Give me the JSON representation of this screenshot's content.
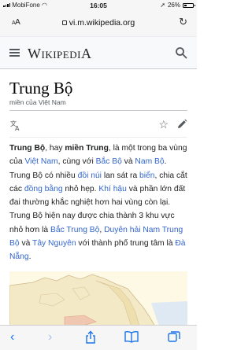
{
  "status_bar": {
    "carrier": "MobiFone",
    "time": "16:05",
    "battery": "26%"
  },
  "browser": {
    "text_size_label": "AA",
    "url": "vi.m.wikipedia.org"
  },
  "wiki": {
    "wordmark": "Wikipedia"
  },
  "page": {
    "title": "Trung Bộ",
    "subtitle": "miền của Việt Nam"
  },
  "article": {
    "p1_bold1": "Trung Bộ",
    "p1_t1": ", hay ",
    "p1_bold2": "miền Trung",
    "p1_t2": ", là một trong ba vùng của ",
    "link_vietnam": "Việt Nam",
    "p1_t3": ", cùng với ",
    "link_bacbo": "Bắc Bộ",
    "p1_t4": " và ",
    "link_nambo": "Nam Bộ",
    "p1_t5": ". Trung Bộ có nhiều ",
    "link_doinui": "đồi núi",
    "p1_t6": " lan sát ra ",
    "link_bien": "biển",
    "p1_t7": ", chia cắt các ",
    "link_dongbang": "đồng bằng",
    "p1_t8": " nhỏ hẹp. ",
    "link_khihau": "Khí hậu",
    "p1_t9": " và phần lớn đất đai thường khắc nghiệt hơn hai vùng còn lại. Trung Bộ hiện nay được chia thành 3 khu vực nhỏ hơn là ",
    "link_bactrungbo": "Bắc Trung Bộ",
    "p1_t10": ", ",
    "link_duyenhai": "Duyên hải Nam Trung Bộ",
    "p1_t11": " và ",
    "link_taynguyen": "Tây Nguyên",
    "p1_t12": " với thành phố trung tâm là ",
    "link_danang": "Đà Nẵng",
    "p1_t13": "."
  },
  "colors": {
    "link": "#3366cc",
    "safari_blue": "#1a73e8"
  },
  "icons": {
    "language": "translate-icon",
    "watch": "star-icon",
    "edit": "pencil-icon"
  }
}
